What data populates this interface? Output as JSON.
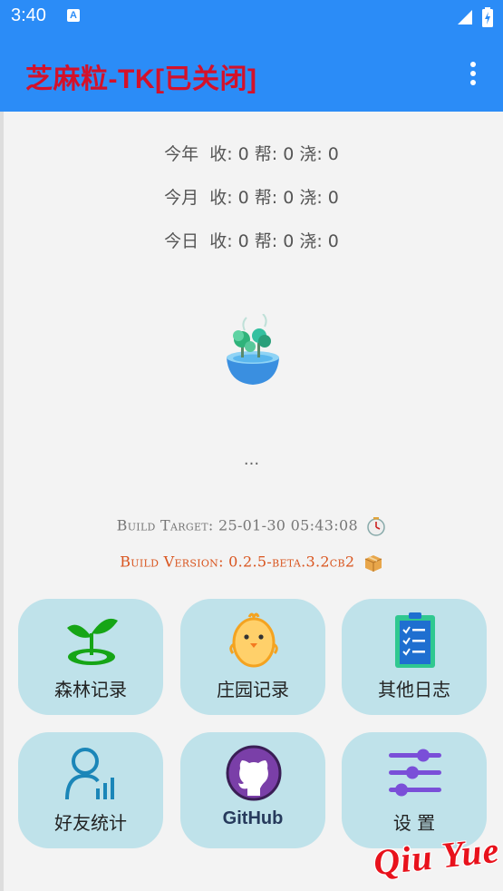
{
  "status_bar": {
    "time": "3:40",
    "notification_icon": "A"
  },
  "app_bar": {
    "title": "芝麻粒-TK[已关闭]",
    "menu_icon": "overflow-menu-icon"
  },
  "stats": [
    {
      "period": "今年",
      "text": "收: 0 帮: 0 浇: 0"
    },
    {
      "period": "今月",
      "text": "收: 0 帮: 0 浇: 0"
    },
    {
      "period": "今日",
      "text": "收: 0 帮: 0 浇: 0"
    }
  ],
  "status_text": "...",
  "build": {
    "target": "Build Target: 25-01-30 05:43:08",
    "version": "Build Version: 0.2.5-beta.3.2cb2"
  },
  "tiles": [
    {
      "label": "森林记录",
      "icon": "sprout-icon"
    },
    {
      "label": "庄园记录",
      "icon": "chick-icon"
    },
    {
      "label": "其他日志",
      "icon": "clipboard-checklist-icon"
    },
    {
      "label": "好友统计",
      "icon": "user-stats-icon"
    },
    {
      "label": "GitHub",
      "icon": "github-icon"
    },
    {
      "label": "设 置",
      "icon": "sliders-icon"
    }
  ],
  "watermark": "Qiu Yue",
  "colors": {
    "primary": "#2b8cf7",
    "title": "#d4112a",
    "tile_bg": "#bfe2ea",
    "version": "#d9541e"
  }
}
